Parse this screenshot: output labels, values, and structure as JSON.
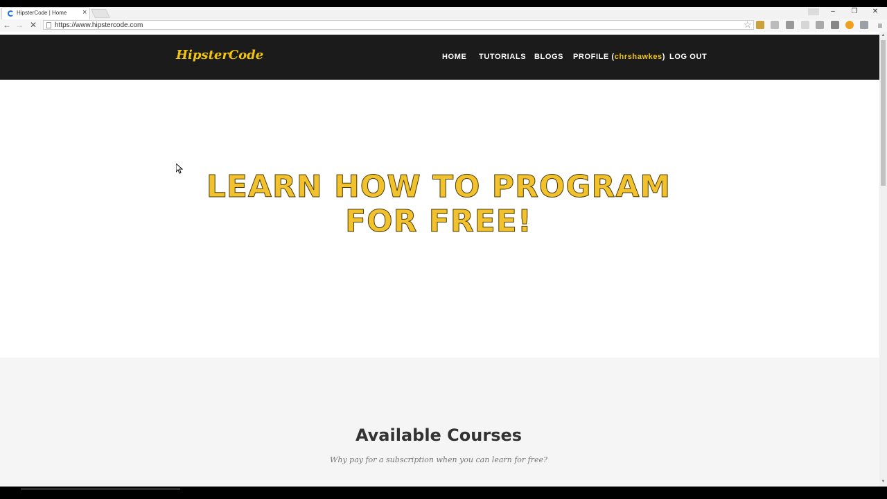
{
  "browser": {
    "tab_title": "HipsterCode | Home",
    "tab_close": "×",
    "url": "https://www.hipstercode.com",
    "window_controls": {
      "minimize": "–",
      "maximize": "❐",
      "close": "✕"
    },
    "nav": {
      "back": "←",
      "forward": "→",
      "stop": "✕"
    },
    "star": "☆",
    "menu": "≡"
  },
  "site": {
    "logo": "HipsterCode",
    "nav": {
      "home": "HOME",
      "tutorials": "TUTORIALS",
      "blogs": "BLOGS",
      "profile_prefix": "PROFILE (",
      "profile_user": "chrshawkes",
      "profile_suffix": ")",
      "logout": "LOG OUT"
    },
    "hero": {
      "title_line1": "LEARN HOW TO PROGRAM",
      "title_line2": "FOR FREE!"
    },
    "courses": {
      "title": "Available Courses",
      "subtitle": "Why pay for a subscription when you can learn for free?"
    }
  },
  "colors": {
    "accent": "#f0c40f",
    "navbar": "#1b1b1b",
    "section_bg": "#f5f5f5"
  }
}
